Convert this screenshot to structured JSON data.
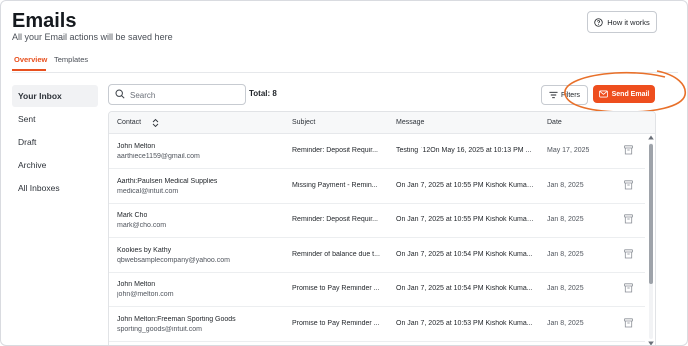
{
  "header": {
    "title": "Emails",
    "subtitle": "All your Email actions will be saved here",
    "how_it_works": "How it works"
  },
  "tabs": [
    {
      "label": "Overview",
      "active": true
    },
    {
      "label": "Templates",
      "active": false
    }
  ],
  "sidebar": {
    "items": [
      {
        "label": "Your Inbox",
        "active": true
      },
      {
        "label": "Sent",
        "active": false
      },
      {
        "label": "Draft",
        "active": false
      },
      {
        "label": "Archive",
        "active": false
      },
      {
        "label": "All Inboxes",
        "active": false
      }
    ]
  },
  "toolbar": {
    "search_placeholder": "Search",
    "total": "Total: 8",
    "filters": "Filters",
    "send_email": "Send Email"
  },
  "table": {
    "columns": [
      "Contact",
      "Subject",
      "Message",
      "Date"
    ],
    "rows": [
      {
        "name": "John Melton",
        "email": "aarthiece1159@gmail.com",
        "subject": "Reminder: Deposit Requir...",
        "message": "Testing `12On May 16, 2025 at 10:13 PM ...",
        "date": "May 17, 2025"
      },
      {
        "name": "Aarthi:Paulsen Medical Supplies",
        "email": "medical@intuit.com",
        "subject": "Missing Payment - Remin...",
        "message": "On Jan 7, 2025 at 10:55 PM Kishok Kumar...",
        "date": "Jan 8, 2025"
      },
      {
        "name": "Mark Cho",
        "email": "mark@cho.com",
        "subject": "Reminder: Deposit Requir...",
        "message": "On Jan 7, 2025 at 10:55 PM Kishok Kumar...",
        "date": "Jan 8, 2025"
      },
      {
        "name": "Kookies by Kathy",
        "email": "qbwebsamplecompany@yahoo.com",
        "subject": "Reminder of balance due t...",
        "message": "On Jan 7, 2025 at 10:54 PM Kishok Kuma...",
        "date": "Jan 8, 2025"
      },
      {
        "name": "John Melton",
        "email": "john@melton.com",
        "subject": "Promise to Pay Reminder ...",
        "message": "On Jan 7, 2025 at 10:54 PM Kishok Kuma...",
        "date": "Jan 8, 2025"
      },
      {
        "name": "John Melton:Freeman Sporting Goods",
        "email": "sporting_goods@intuit.com",
        "subject": "Promise to Pay Reminder ...",
        "message": "On Jan 7, 2025 at 10:53 PM Kishok Kuma...",
        "date": "Jan 8, 2025"
      }
    ]
  },
  "colors": {
    "accent": "#ee4e1e",
    "highlight_ring": "#e8702a"
  }
}
